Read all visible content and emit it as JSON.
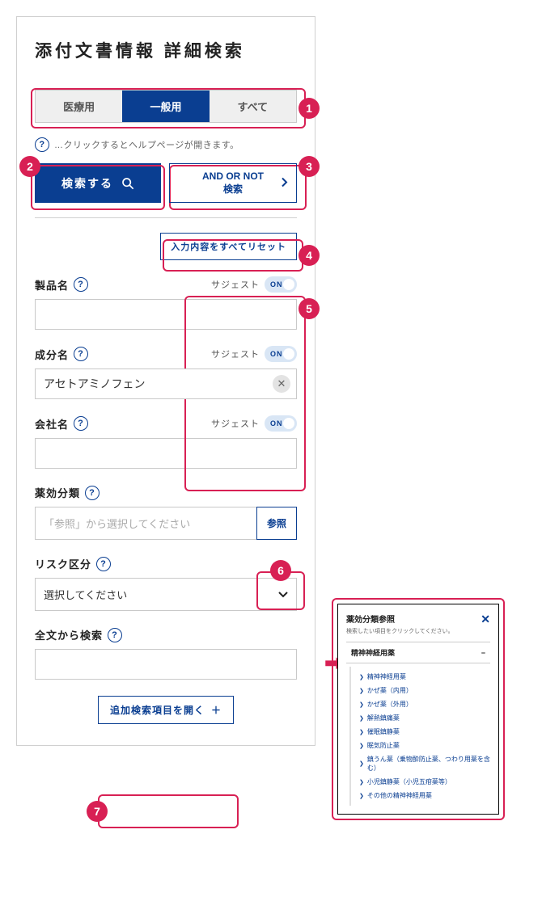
{
  "title": "添付文書情報 詳細検索",
  "tabs": {
    "medical": "医療用",
    "general": "一般用",
    "all": "すべて"
  },
  "help_note": "…クリックするとヘルプページが開きます。",
  "buttons": {
    "search": "検索する",
    "andor_l1": "AND OR NOT",
    "andor_l2": "検索",
    "reset": "入力内容をすべてリセット",
    "lookup": "参照",
    "more": "追加検索項目を開く"
  },
  "labels": {
    "product": "製品名",
    "ingredient": "成分名",
    "company": "会社名",
    "category": "薬効分類",
    "risk": "リスク区分",
    "fulltext": "全文から検索",
    "suggest": "サジェスト",
    "on": "ON"
  },
  "values": {
    "product": "",
    "ingredient": "アセトアミノフェン",
    "company": "",
    "category_ph": "「参照」から選択してください",
    "risk_ph": "選択してください",
    "fulltext": ""
  },
  "badges": {
    "b1": "1",
    "b2": "2",
    "b3": "3",
    "b4": "4",
    "b5": "5",
    "b6": "6",
    "b7": "7"
  },
  "popup": {
    "title": "薬効分類参照",
    "sub": "検索したい項目をクリックしてください。",
    "cat": "精神神経用薬",
    "items": [
      "精神神経用薬",
      "かぜ薬（内用）",
      "かぜ薬（外用）",
      "解熱鎮痛薬",
      "催眠鎮静薬",
      "眠気防止薬",
      "鎮うん薬（乗物酔防止薬、つわり用薬を含む）",
      "小児鎮静薬（小児五疳薬等）",
      "その他の精神神経用薬"
    ]
  }
}
